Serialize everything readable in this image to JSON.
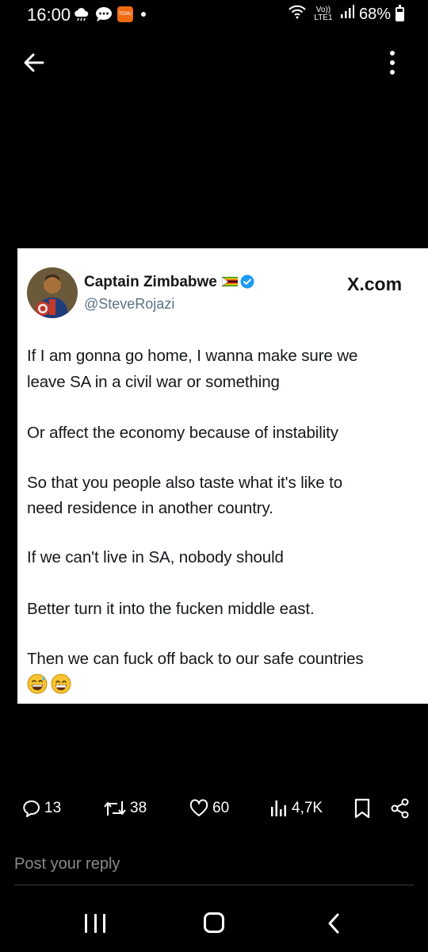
{
  "status_bar": {
    "time": "16:00",
    "network": "Vo)) LTE1",
    "battery": "68%",
    "battery_level": 0.68,
    "icons_left": [
      "weather-icon",
      "chat-bubble-icon",
      "temu-app-icon",
      "notification-dot"
    ],
    "temu_label": "TEMU"
  },
  "top_bar": {
    "back_icon": "arrow-left-icon",
    "menu_icon": "more-vertical-icon"
  },
  "tweet": {
    "author_name": "Captain Zimbabwe",
    "author_handle": "@SteveRojazi",
    "source": "X.com",
    "flag_icon": "zimbabwe-flag-icon",
    "verified_icon": "verified-badge-icon",
    "text_lines": [
      "If I am gonna go home, I wanna make sure we",
      "leave SA in a civil war or something",
      "Or affect the economy because of instability",
      "So that you people also taste what it's like to",
      "need residence in another country.",
      "If we can't live in SA, nobody should",
      "Better turn it into the fucken middle east.",
      "Then we can fuck off back to our safe countries"
    ],
    "emojis": [
      "grinning-sweat-emoji",
      "grinning-squinting-emoji"
    ]
  },
  "actions": {
    "replies": "13",
    "reposts": "38",
    "likes": "60",
    "views": "4,7K"
  },
  "reply": {
    "placeholder": "Post your reply"
  },
  "colors": {
    "background": "#000000",
    "card": "#ffffff",
    "verified_blue": "#1d9bf0",
    "handle_gray": "#5b7083",
    "temu_orange": "#f06a12"
  }
}
